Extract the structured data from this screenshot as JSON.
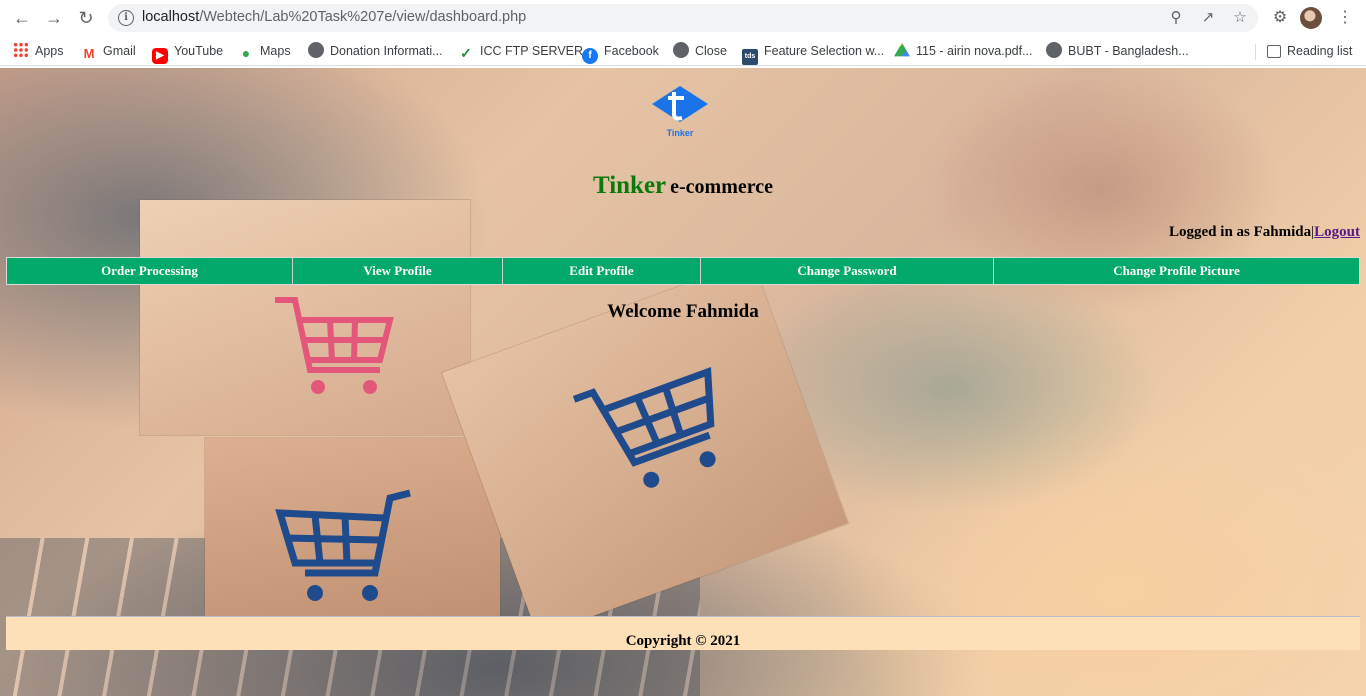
{
  "browser": {
    "url_host": "localhost",
    "url_path": "/Webtech/Lab%20Task%207e/view/dashboard.php",
    "bookmarks": [
      {
        "label": "Apps",
        "icon": "apps-grid-icon"
      },
      {
        "label": "Gmail",
        "icon": "gmail-icon"
      },
      {
        "label": "YouTube",
        "icon": "youtube-icon"
      },
      {
        "label": "Maps",
        "icon": "maps-icon"
      },
      {
        "label": "Donation Informati...",
        "icon": "globe-icon"
      },
      {
        "label": "ICC FTP SERVER",
        "icon": "icc-icon"
      },
      {
        "label": "Facebook",
        "icon": "facebook-icon"
      },
      {
        "label": "Close",
        "icon": "globe-icon"
      },
      {
        "label": "Feature Selection w...",
        "icon": "tds-icon"
      },
      {
        "label": "115 - airin nova.pdf...",
        "icon": "google-drive-icon"
      },
      {
        "label": "BUBT - Bangladesh...",
        "icon": "globe-icon"
      }
    ],
    "reading_list": "Reading list",
    "tds_icon_text": "tds"
  },
  "site": {
    "logo_text": "Tinker",
    "brand": "Tinker",
    "brand_sub": "e-commerce",
    "login_prefix": "Logged in as Fahmida",
    "login_sep": "|",
    "logout": "Logout",
    "menu": [
      "Order Processing",
      "View Profile",
      "Edit Profile",
      "Change Password",
      "Change Profile Picture"
    ],
    "welcome": "Welcome Fahmida",
    "footer": "Copyright © 2021",
    "colors": {
      "menu_bg": "#03a86b",
      "brand": "#0a7a0a",
      "footer_bg": "#fde0b8"
    }
  }
}
